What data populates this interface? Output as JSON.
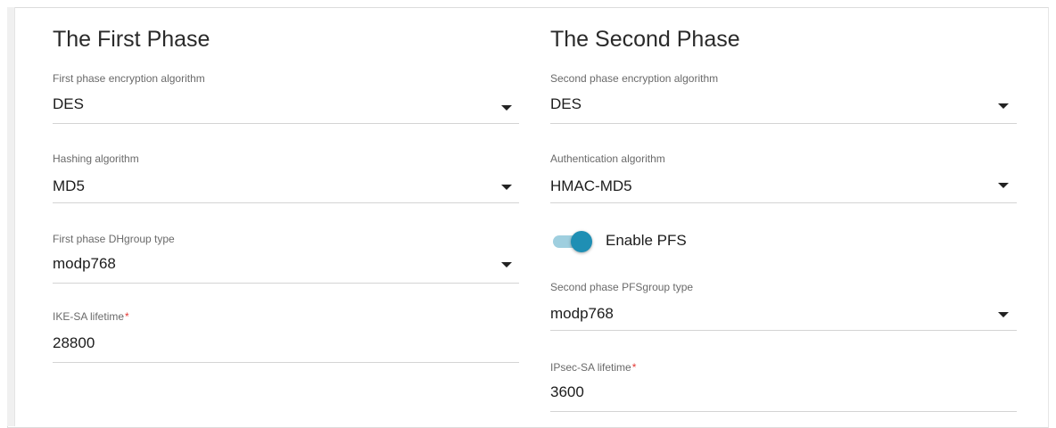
{
  "first_phase": {
    "title": "The First Phase",
    "encryption": {
      "label": "First phase encryption algorithm",
      "value": "DES"
    },
    "hashing": {
      "label": "Hashing algorithm",
      "value": "MD5"
    },
    "dhgroup": {
      "label": "First phase DHgroup type",
      "value": "modp768"
    },
    "ike_lifetime": {
      "label": "IKE-SA lifetime",
      "required_mark": "*",
      "value": "28800"
    }
  },
  "second_phase": {
    "title": "The Second Phase",
    "encryption": {
      "label": "Second phase encryption algorithm",
      "value": "DES"
    },
    "authentication": {
      "label": "Authentication algorithm",
      "value": "HMAC-MD5"
    },
    "pfs": {
      "label": "Enable PFS",
      "enabled": true
    },
    "pfsgroup": {
      "label": "Second phase PFSgroup type",
      "value": "modp768"
    },
    "ipsec_lifetime": {
      "label": "IPsec-SA lifetime",
      "required_mark": "*",
      "value": "3600"
    }
  },
  "colors": {
    "toggle_track": "#9fcfdf",
    "toggle_knob": "#1f8fb4",
    "required_mark": "#e53935",
    "underline": "#d4d4d4"
  },
  "icons": {
    "dropdown": "chevron-down-icon"
  }
}
